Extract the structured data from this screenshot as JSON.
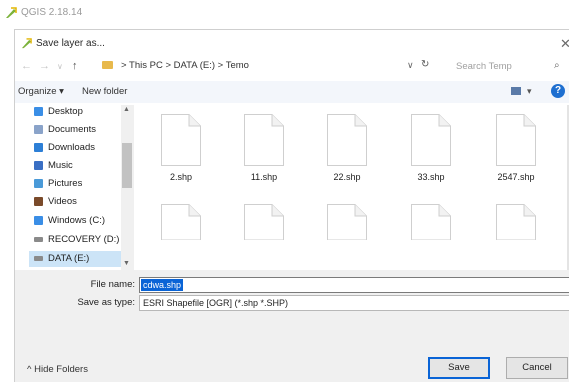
{
  "app_title": "QGIS 2.18.14",
  "dialog_title": "Save layer as...",
  "address": {
    "crumbs": [
      "This PC",
      "DATA (E:)",
      "Temo"
    ],
    "separator": ">"
  },
  "search_placeholder": "Search Temp",
  "toolbar": {
    "organize": "Organize ▾",
    "new_folder": "New folder"
  },
  "nav_items": [
    {
      "label": "Desktop",
      "icon": "desktop-folder-icon",
      "color": "#3a8ee6"
    },
    {
      "label": "Documents",
      "icon": "documents-icon",
      "color": "#8aa3c9"
    },
    {
      "label": "Downloads",
      "icon": "downloads-icon",
      "color": "#2d7fd6"
    },
    {
      "label": "Music",
      "icon": "music-icon",
      "color": "#3a6fc4"
    },
    {
      "label": "Pictures",
      "icon": "pictures-icon",
      "color": "#4a9ad8"
    },
    {
      "label": "Videos",
      "icon": "videos-icon",
      "color": "#7a4a2a"
    },
    {
      "label": "Windows (C:)",
      "icon": "windows-drive-icon",
      "color": "#3a8ee6"
    },
    {
      "label": "RECOVERY (D:)",
      "icon": "drive-icon",
      "color": "#8a8a8a"
    },
    {
      "label": "DATA (E:)",
      "icon": "drive-icon",
      "color": "#8a8a8a",
      "selected": true
    }
  ],
  "files_row1": [
    "2.shp",
    "11.shp",
    "22.shp",
    "33.shp",
    "2547.shp"
  ],
  "form": {
    "file_name_label": "File name:",
    "file_name_value": "cdwa.shp",
    "save_type_label": "Save as type:",
    "save_type_value": "ESRI Shapefile [OGR] (*.shp *.SHP)"
  },
  "hide_folders": "^  Hide Folders",
  "save_label": "Save",
  "cancel_label": "Cancel",
  "accent_color": "#0a64d6"
}
